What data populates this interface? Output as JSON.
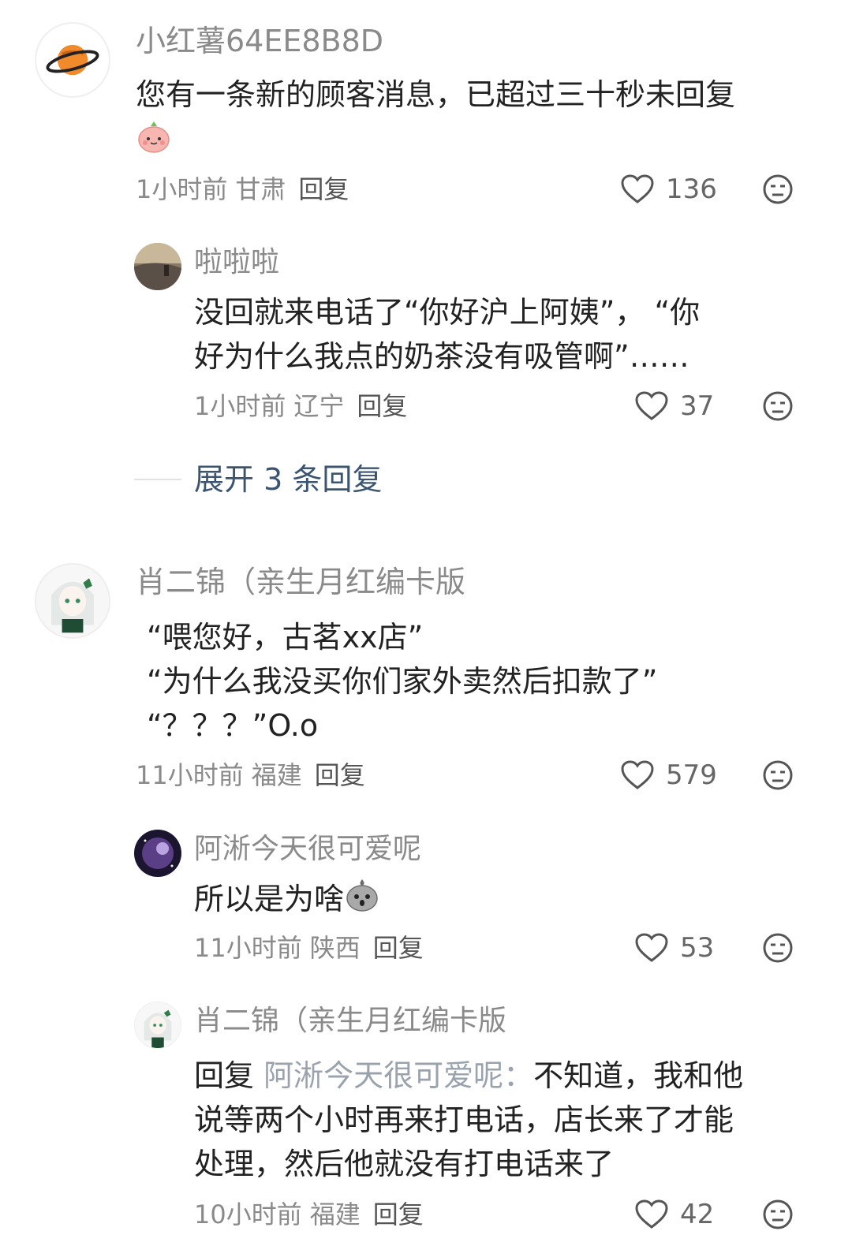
{
  "comments": [
    {
      "author": "小红薯64EE8B8D",
      "text_line1": "您有一条新的顾客消息，已超过三十秒未回复",
      "emoji": "cute-blob-emoji",
      "time": "1小时前",
      "location": "甘肃",
      "reply_label": "回复",
      "likes": "136"
    },
    {
      "author": "啦啦啦",
      "text_line1": "没回就来电话了“你好沪上阿姨”，  “你",
      "text_line2": "好为什么我点的奶茶没有吸管啊”……",
      "time": "1小时前",
      "location": "辽宁",
      "reply_label": "回复",
      "likes": "37"
    },
    {
      "expand_label": "展开 3 条回复"
    },
    {
      "author": "肖二锦（亲生月红编卡版",
      "text_line1": "“喂您好，古茗xx店”",
      "text_line2": "“为什么我没买你们家外卖然后扣款了”",
      "text_line3": "“？？？”O.o",
      "time": "11小时前",
      "location": "福建",
      "reply_label": "回复",
      "likes": "579"
    },
    {
      "author": "阿淅今天很可爱呢",
      "text_line1": "所以是为啥",
      "emoji": "grey-blob-emoji",
      "time": "11小时前",
      "location": "陕西",
      "reply_label": "回复",
      "likes": "53"
    },
    {
      "author": "肖二锦（亲生月红编卡版",
      "reply_prefix": "回复",
      "reply_to": "阿淅今天很可爱呢：",
      "text_line1": "不知道，我和他",
      "text_line2": "说等两个小时再来打电话，店长来了才能",
      "text_line3": "处理，然后他就没有打电话来了",
      "time": "10小时前",
      "location": "福建",
      "reply_label": "回复",
      "likes": "42"
    }
  ],
  "colors": {
    "name": "#8a8a8a",
    "text": "#222222",
    "expand": "#3b5470",
    "icon": "#666666"
  }
}
